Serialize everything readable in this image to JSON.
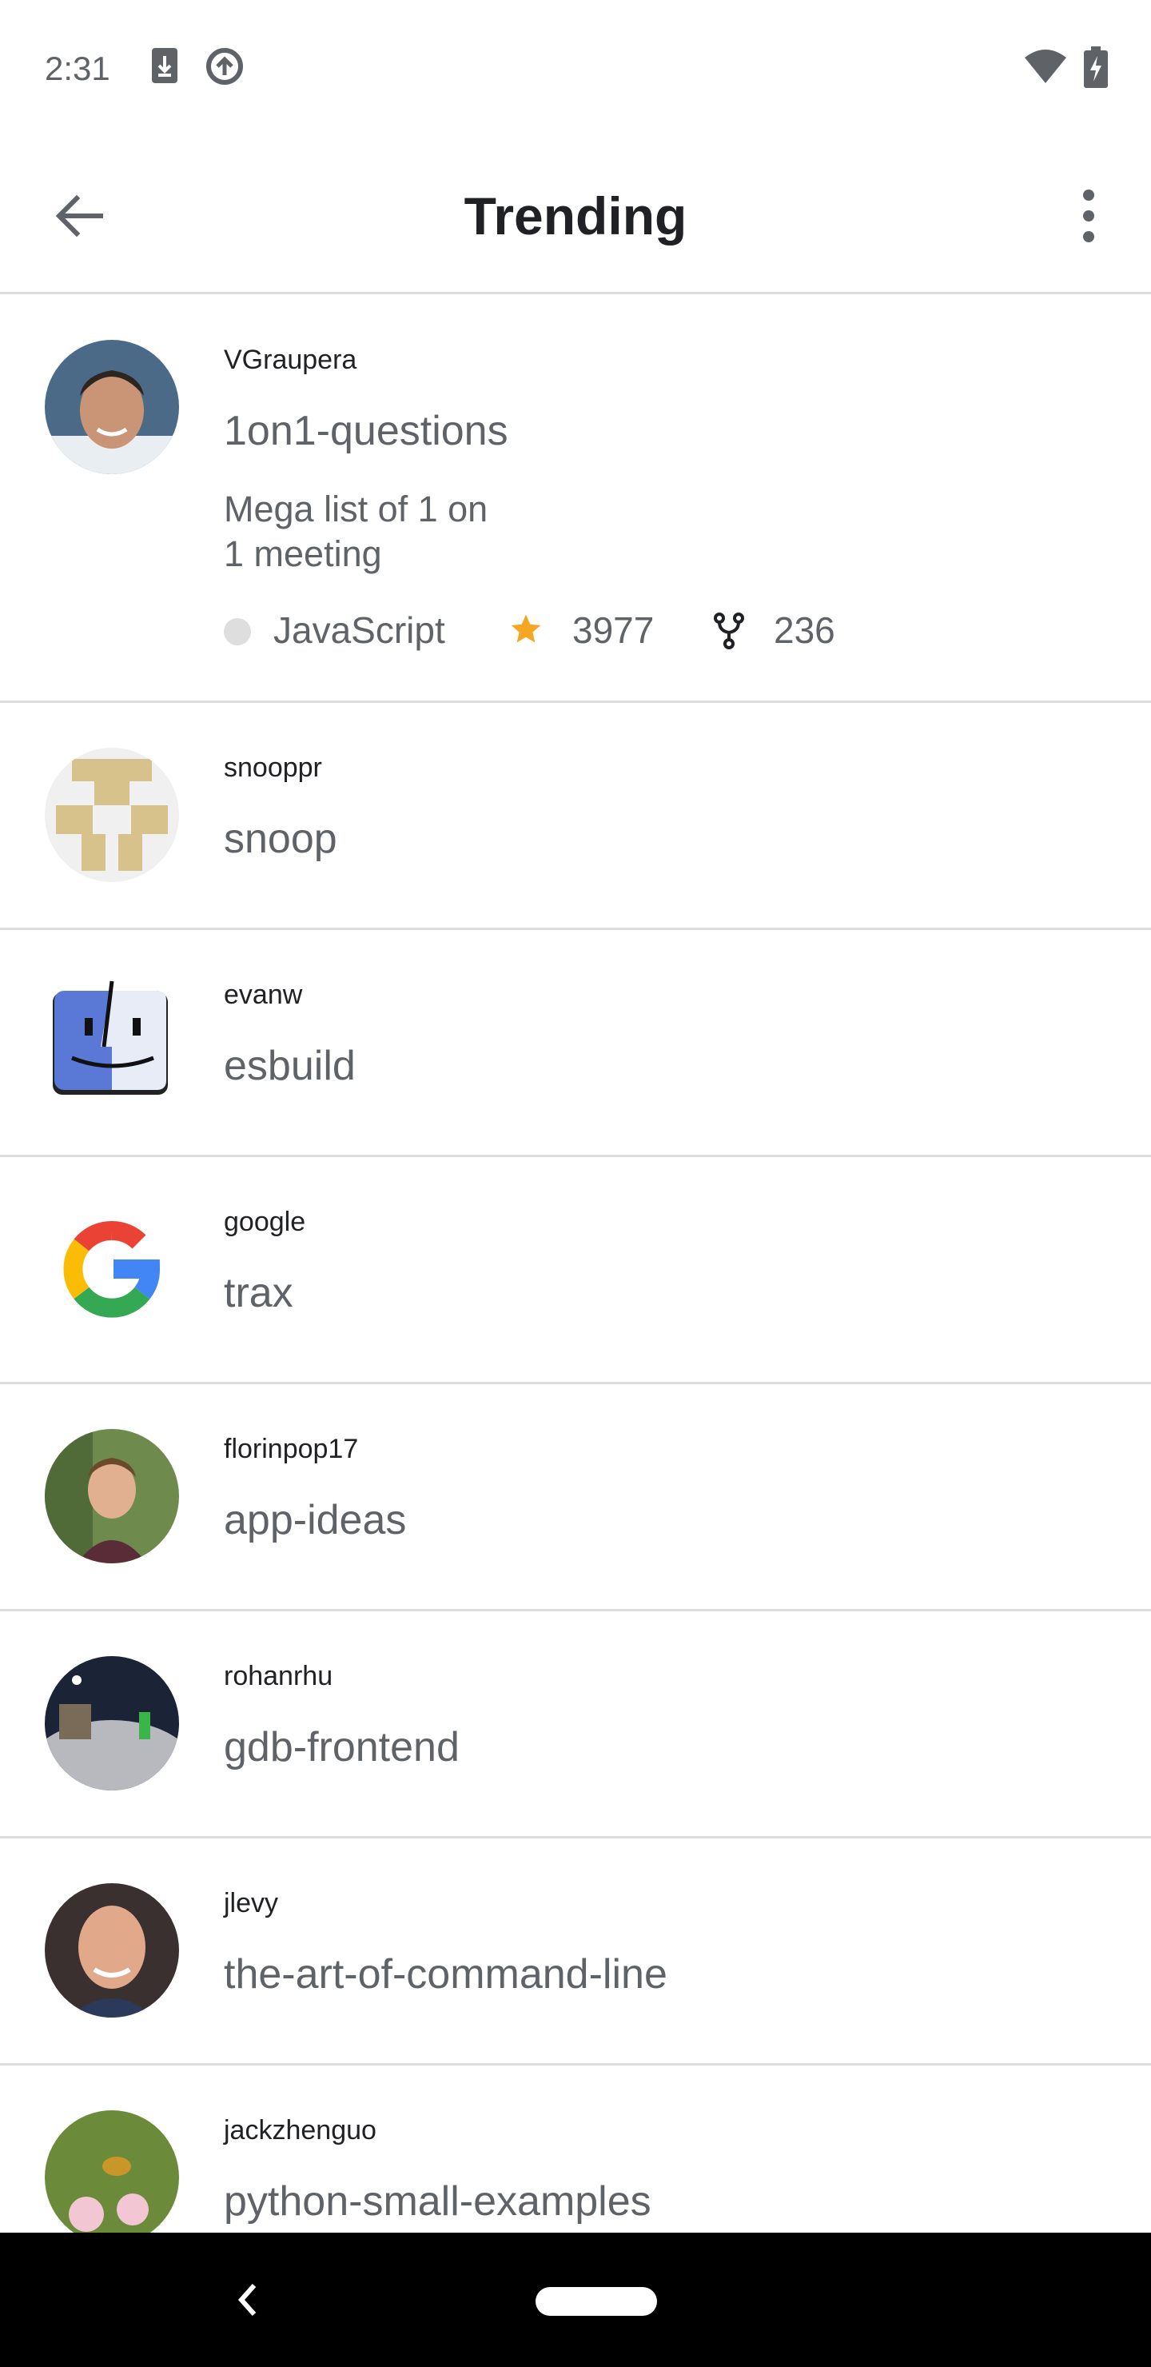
{
  "status_bar": {
    "time": "2:31",
    "icons": [
      "download-icon",
      "do-not-disturb-icon",
      "wifi-icon",
      "battery-charging-icon"
    ]
  },
  "app_bar": {
    "title": "Trending",
    "back_icon": "arrow-back-icon",
    "more_icon": "more-vert-icon"
  },
  "repos": [
    {
      "owner": "VGraupera",
      "name": "1on1-questions",
      "description_line1": "Mega list of 1 on",
      "description_line2": "1 meeting",
      "language": "JavaScript",
      "stars": "3977",
      "forks": "236",
      "language_color": "#dedede",
      "star_color": "#f5a623"
    },
    {
      "owner": "snooppr",
      "name": "snoop"
    },
    {
      "owner": "evanw",
      "name": "esbuild"
    },
    {
      "owner": "google",
      "name": "trax"
    },
    {
      "owner": "florinpop17",
      "name": "app-ideas"
    },
    {
      "owner": "rohanrhu",
      "name": "gdb-frontend"
    },
    {
      "owner": "jlevy",
      "name": "the-art-of-command-line"
    },
    {
      "owner": "jackzhenguo",
      "name": "python-small-examples"
    }
  ],
  "nav_bar": {
    "back_icon": "nav-back-icon",
    "home_icon": "home-pill-icon"
  }
}
